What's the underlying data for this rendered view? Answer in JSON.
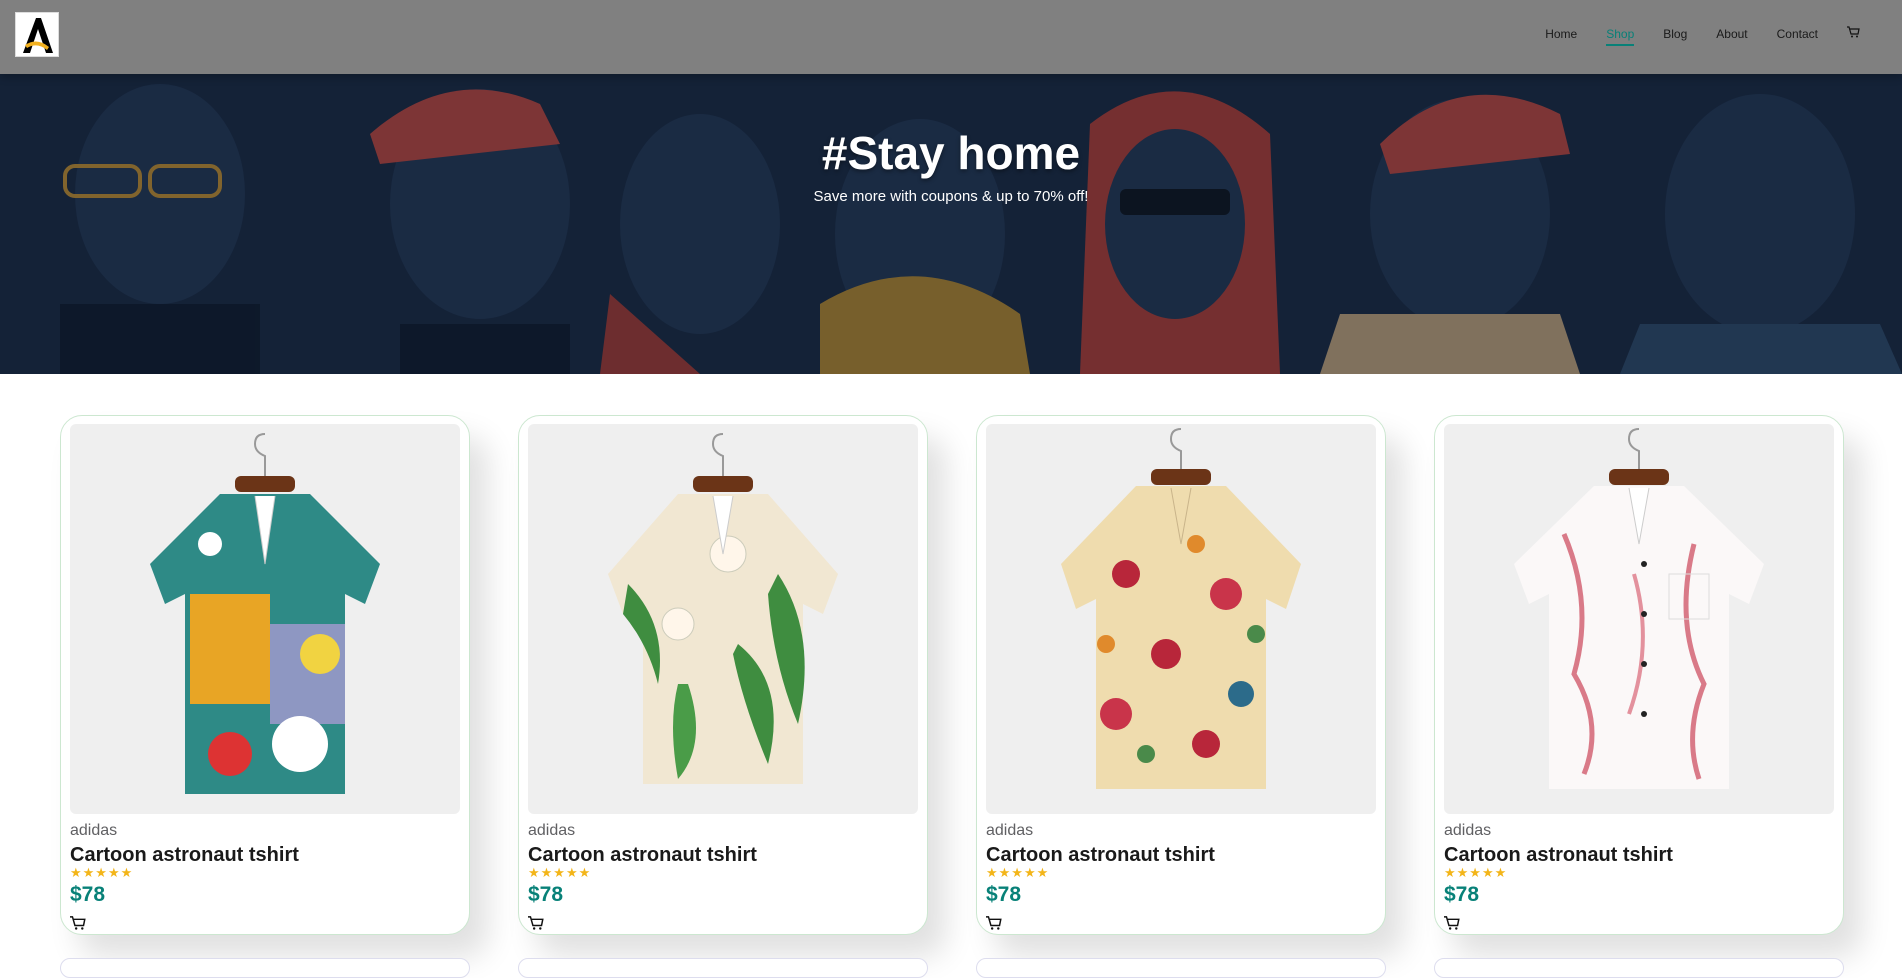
{
  "header": {
    "logo_letter": "A",
    "nav": [
      "Home",
      "Shop",
      "Blog",
      "About",
      "Contact"
    ],
    "active_nav": "Shop",
    "cart_icon": "cart-icon"
  },
  "hero": {
    "title": "#Stay home",
    "subtitle": "Save more with coupons & up to 70% off!"
  },
  "products": [
    {
      "brand": "adidas",
      "name": "Cartoon astronaut tshirt",
      "stars": "★★★★★",
      "price": "$78",
      "pattern": "abstract-teal-yellow"
    },
    {
      "brand": "adidas",
      "name": "Cartoon astronaut tshirt",
      "stars": "★★★★★",
      "price": "$78",
      "pattern": "lily-green-cream"
    },
    {
      "brand": "adidas",
      "name": "Cartoon astronaut tshirt",
      "stars": "★★★★★",
      "price": "$78",
      "pattern": "floral-red-cream"
    },
    {
      "brand": "adidas",
      "name": "Cartoon astronaut tshirt",
      "stars": "★★★★★",
      "price": "$78",
      "pattern": "blossom-pink-white"
    }
  ],
  "colors": {
    "accent": "#088178",
    "header_bg": "#808080",
    "star": "#f3b519"
  }
}
